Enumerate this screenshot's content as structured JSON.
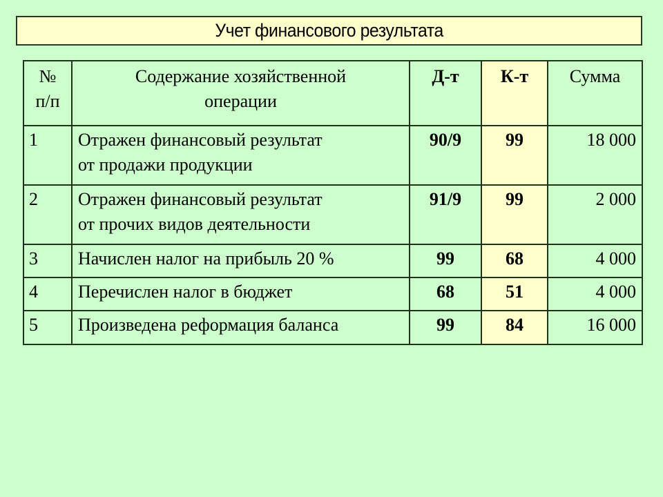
{
  "title": "Учет финансового результата",
  "colors": {
    "background": "#ccffcc",
    "title_box": "#ffffcc",
    "credit_column": "#ffffcc",
    "border": "#1f3319"
  },
  "table": {
    "headers": {
      "num_line1": "№",
      "num_line2": "п/п",
      "description_line1": "Содержание хозяйственной",
      "description_line2": "операции",
      "debit": "Д-т",
      "credit": "К-т",
      "amount": "Сумма"
    },
    "rows": [
      {
        "num": "1",
        "description_line1": "Отражен финансовый результат",
        "description_line2": "от продажи продукции",
        "debit": "90/9",
        "credit": "99",
        "amount": "18 000"
      },
      {
        "num": "2",
        "description_line1": "Отражен финансовый результат",
        "description_line2": "от прочих видов деятельности",
        "debit": "91/9",
        "credit": "99",
        "amount": "2 000"
      },
      {
        "num": "3",
        "description_line1": "Начислен налог на прибыль 20 %",
        "description_line2": "",
        "debit": "99",
        "credit": "68",
        "amount": "4 000"
      },
      {
        "num": "4",
        "description_line1": "Перечислен налог в бюджет",
        "description_line2": "",
        "debit": "68",
        "credit": "51",
        "amount": "4 000"
      },
      {
        "num": "5",
        "description_line1": "Произведена реформация баланса",
        "description_line2": "",
        "debit": "99",
        "credit": "84",
        "amount": "16 000"
      }
    ]
  }
}
